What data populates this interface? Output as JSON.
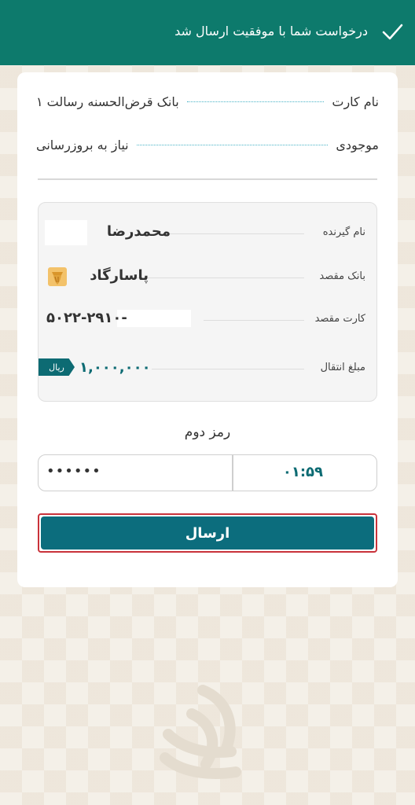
{
  "header": {
    "message": "درخواست شما با موفقیت ارسال شد",
    "icon": "check-icon"
  },
  "card_info": {
    "card_name_label": "نام کارت",
    "card_name_value": "بانک قرض‌الحسنه رسالت ۱",
    "balance_label": "موجودی",
    "balance_value": "نیاز به بروزرسانی"
  },
  "transfer": {
    "recipient_label": "نام گیرنده",
    "recipient_value": "محمدرضا",
    "dest_bank_label": "بانک مقصد",
    "dest_bank_value": "پاسارگاد",
    "dest_bank_icon": "pasargad-logo-icon",
    "dest_card_label": "کارت مقصد",
    "dest_card_value": "۵۰۲۲-۲۹۱۰-",
    "amount_label": "مبلغ انتقال",
    "amount_value": "۱,۰۰۰,۰۰۰",
    "currency": "ریال"
  },
  "password": {
    "title": "رمز دوم",
    "value": "••••••",
    "timer": "۰۱:۵۹"
  },
  "submit": {
    "label": "ارسال"
  },
  "colors": {
    "header_bg": "#0d7a6c",
    "button_bg": "#0c6d7d",
    "accent_teal": "#0d6b73",
    "highlight_border": "#c9323a"
  }
}
